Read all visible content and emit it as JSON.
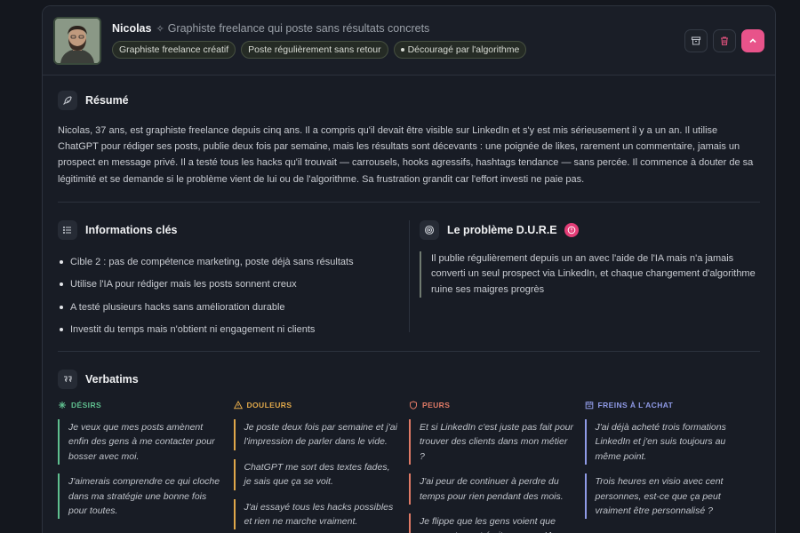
{
  "header": {
    "name": "Nicolas",
    "subtitle": "Graphiste freelance qui poste sans résultats concrets",
    "tags": [
      "Graphiste freelance créatif",
      "Poste régulièrement sans retour",
      "Découragé par l'algorithme"
    ]
  },
  "summary": {
    "title": "Résumé",
    "text": "Nicolas, 37 ans, est graphiste freelance depuis cinq ans. Il a compris qu'il devait être visible sur LinkedIn et s'y est mis sérieusement il y a un an. Il utilise ChatGPT pour rédiger ses posts, publie deux fois par semaine, mais les résultats sont décevants : une poignée de likes, rarement un commentaire, jamais un prospect en message privé. Il a testé tous les hacks qu'il trouvait — carrousels, hooks agressifs, hashtags tendance — sans percée. Il commence à douter de sa légitimité et se demande si le problème vient de lui ou de l'algorithme. Sa frustration grandit car l'effort investi ne paie pas."
  },
  "key_info": {
    "title": "Informations clés",
    "items": [
      "Cible 2 : pas de compétence marketing, poste déjà sans résultats",
      "Utilise l'IA pour rédiger mais les posts sonnent creux",
      "A testé plusieurs hacks sans amélioration durable",
      "Investit du temps mais n'obtient ni engagement ni clients"
    ]
  },
  "problem": {
    "title": "Le problème D.U.R.E",
    "text": "Il publie régulièrement depuis un an avec l'aide de l'IA mais n'a jamais converti un seul prospect via LinkedIn, et chaque changement d'algorithme ruine ses maigres progrès"
  },
  "verbatims": {
    "title": "Verbatims",
    "columns": [
      {
        "label": "DÉSIRS",
        "color": "#5fbf8f",
        "icon": "sparkle-icon",
        "quotes": [
          "Je veux que mes posts amènent enfin des gens à me contacter pour bosser avec moi.",
          "J'aimerais comprendre ce qui cloche dans ma stratégie une bonne fois pour toutes."
        ]
      },
      {
        "label": "DOULEURS",
        "color": "#e0a84a",
        "icon": "warning-icon",
        "quotes": [
          "Je poste deux fois par semaine et j'ai l'impression de parler dans le vide.",
          "ChatGPT me sort des textes fades, je sais que ça se voit.",
          "J'ai essayé tous les hacks possibles et rien ne marche vraiment."
        ]
      },
      {
        "label": "PEURS",
        "color": "#e07a66",
        "icon": "shield-icon",
        "quotes": [
          "Et si LinkedIn c'est juste pas fait pour trouver des clients dans mon métier ?",
          "J'ai peur de continuer à perdre du temps pour rien pendant des mois.",
          "Je flippe que les gens voient que mes posts sont écrits par une IA."
        ]
      },
      {
        "label": "FREINS À L'ACHAT",
        "color": "#8f9ae6",
        "icon": "calendar-icon",
        "quotes": [
          "J'ai déjà acheté trois formations LinkedIn et j'en suis toujours au même point.",
          "Trois heures en visio avec cent personnes, est-ce que ça peut vraiment être personnalisé ?"
        ]
      }
    ]
  }
}
